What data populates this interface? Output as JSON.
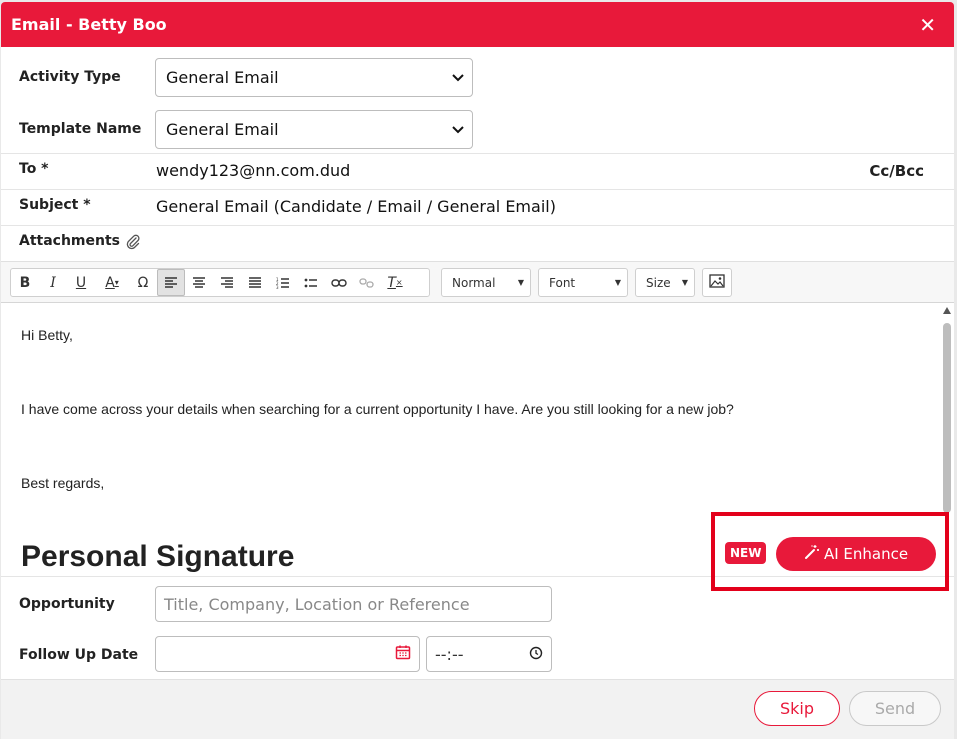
{
  "header": {
    "title": "Email - Betty Boo",
    "close_glyph": "✕"
  },
  "form": {
    "activity_type": {
      "label": "Activity Type",
      "value": "General Email"
    },
    "template_name": {
      "label": "Template Name",
      "value": "General Email"
    },
    "to": {
      "label": "To *",
      "value": "wendy123@nn.com.dud",
      "ccbcc": "Cc/Bcc"
    },
    "subject": {
      "label": "Subject *",
      "value": "General Email (Candidate / Email / General Email)"
    },
    "attachments": {
      "label": "Attachments"
    }
  },
  "toolbar": {
    "format": "Normal",
    "font": "Font",
    "size": "Size"
  },
  "editor": {
    "greeting": "Hi Betty,",
    "body": "I have come across your details when searching for a current opportunity I have. Are you still looking for a new job?",
    "closing": "Best regards,",
    "signature": "Personal Signature"
  },
  "ai": {
    "badge": "NEW",
    "label": "AI Enhance"
  },
  "opportunity": {
    "label": "Opportunity",
    "placeholder": "Title, Company, Location or Reference"
  },
  "follow_up": {
    "label": "Follow Up Date",
    "time_placeholder": "--:--"
  },
  "footer": {
    "skip": "Skip",
    "send": "Send"
  },
  "colors": {
    "accent": "#e8193a",
    "highlight": "#e3001b"
  }
}
